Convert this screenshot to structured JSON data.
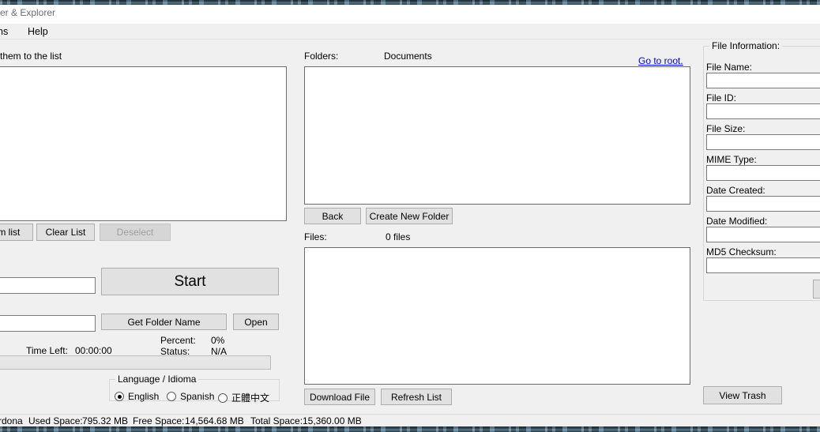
{
  "window": {
    "title": "er & Explorer",
    "menu": [
      {
        "label": "ns"
      },
      {
        "label": "Help"
      }
    ]
  },
  "left_panel": {
    "instruction": "them to the list",
    "list_items": [],
    "buttons": {
      "remove_from_list": "om list",
      "clear_list": "Clear List",
      "deselect": "Deselect"
    },
    "folder_field_value": "",
    "path_field_value": "",
    "start_button": "Start",
    "get_folder_name_button": "Get Folder Name",
    "open_button": "Open",
    "progress": {
      "time_left_label": "Time Left:",
      "time_left_value": "00:00:00",
      "percent_label": "Percent:",
      "percent_value": "0%",
      "status_label": "Status:",
      "status_value": "N/A",
      "bar_percent": 0
    },
    "language": {
      "group_title": "Language / Idioma",
      "options": [
        {
          "label": "English",
          "selected": true
        },
        {
          "label": "Spanish",
          "selected": false
        },
        {
          "label": "正體中文",
          "selected": false
        }
      ]
    }
  },
  "middle_panel": {
    "folders_label": "Folders:",
    "current_folder": "Documents",
    "go_to_root_link": "Go to root.",
    "folders_items": [],
    "back_button": "Back",
    "create_new_folder_button": "Create New Folder",
    "files_label": "Files:",
    "files_count": "0 files",
    "files_items": [],
    "download_file_button": "Download File",
    "refresh_list_button": "Refresh List"
  },
  "right_panel": {
    "group_title": "File Information:",
    "fields": [
      {
        "label": "File Name:",
        "value": ""
      },
      {
        "label": "File ID:",
        "value": ""
      },
      {
        "label": "File Size:",
        "value": ""
      },
      {
        "label": "MIME Type:",
        "value": ""
      },
      {
        "label": "Date Created:",
        "value": ""
      },
      {
        "label": "Date Modified:",
        "value": ""
      },
      {
        "label": "MD5 Checksum:",
        "value": ""
      }
    ],
    "clipped_button": "",
    "view_trash_button": "View Trash"
  },
  "statusbar": {
    "account": "rdona",
    "used_space_label": "Used Space:",
    "used_space_value": "795.32 MB",
    "free_space_label": "Free Space:",
    "free_space_value": "14,564.68 MB",
    "total_space_label": "Total Space:",
    "total_space_value": "15,360.00 MB"
  }
}
